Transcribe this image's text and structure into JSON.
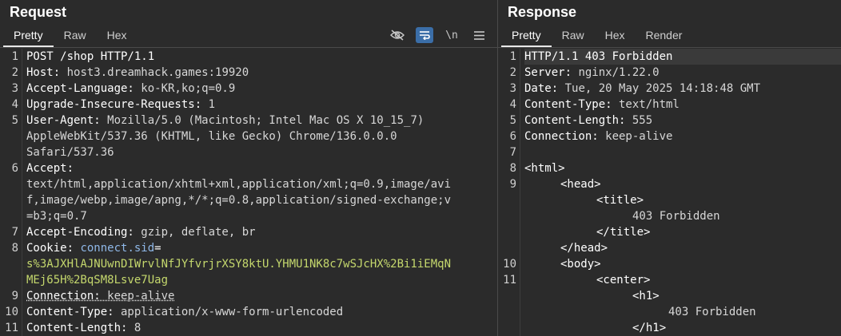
{
  "request": {
    "title": "Request",
    "tabs": [
      "Pretty",
      "Raw",
      "Hex"
    ],
    "active_tab": "Pretty",
    "tool_icons": [
      "eye-off-icon",
      "wrap-icon",
      "newline-icon",
      "menu-icon"
    ],
    "newline_label": "\\n",
    "line_numbers": [
      "1",
      "2",
      "3",
      "4",
      "5",
      "6",
      "7",
      "8",
      "9",
      "10",
      "11"
    ],
    "lines": {
      "l1": "POST /shop HTTP/1.1",
      "l2k": "Host:",
      "l2v": " host3.dreamhack.games:19920",
      "l3k": "Accept-Language:",
      "l3v": " ko-KR,ko;q=0.9",
      "l4k": "Upgrade-Insecure-Requests:",
      "l4v": " 1",
      "l5k": "User-Agent:",
      "l5v": " Mozilla/5.0 (Macintosh; Intel Mac OS X 10_15_7)",
      "l5c1": "AppleWebKit/537.36 (KHTML, like Gecko) Chrome/136.0.0.0",
      "l5c2": "Safari/537.36",
      "l6k": "Accept:",
      "l6c1": "text/html,application/xhtml+xml,application/xml;q=0.9,image/avi",
      "l6c2": "f,image/webp,image/apng,*/*;q=0.8,application/signed-exchange;v",
      "l6c3": "=b3;q=0.7",
      "l7k": "Accept-Encoding:",
      "l7v": " gzip, deflate, br",
      "l8k": "Cookie:",
      "l8ck": "connect.sid",
      "l8eq": "=",
      "l8c1": "s%3AJXHlAJNUwnDIWrvlNfJYfvrjrXSY8ktU.YHMU1NK8c7wSJcHX%2Bi1iEMqN",
      "l8c2": "MEj65H%2BqSM8Lsve7Uag",
      "l9k": "Connection:",
      "l9v": " keep-alive",
      "l10k": "Content-Type:",
      "l10v": " application/x-www-form-urlencoded",
      "l11k": "Content-Length:",
      "l11v": " 8"
    }
  },
  "response": {
    "title": "Response",
    "tabs": [
      "Pretty",
      "Raw",
      "Hex",
      "Render"
    ],
    "active_tab": "Pretty",
    "line_numbers": [
      "1",
      "2",
      "3",
      "4",
      "5",
      "6",
      "7",
      "8",
      "9",
      "10",
      "11"
    ],
    "lines": {
      "l1": "HTTP/1.1 403 Forbidden",
      "l2k": "Server:",
      "l2v": " nginx/1.22.0",
      "l3k": "Date:",
      "l3v": " Tue, 20 May 2025 14:18:48 GMT",
      "l4k": "Content-Type:",
      "l4v": " text/html",
      "l5k": "Content-Length:",
      "l5v": " 555",
      "l6k": "Connection:",
      "l6v": " keep-alive",
      "l8": "<html>",
      "l9": "<head>",
      "l9a": "<title>",
      "l9b": "403 Forbidden",
      "l9c": "</title>",
      "l9d": "</head>",
      "l10": "<body>",
      "l11": "<center>",
      "l11a": "<h1>",
      "l11b": "403 Forbidden",
      "l11c": "</h1>"
    }
  },
  "colors": {
    "background": "#2b2b2b",
    "cookie_name": "#8fb8e8",
    "cookie_value": "#c5d86d",
    "active_tool": "#3b6ea8"
  }
}
